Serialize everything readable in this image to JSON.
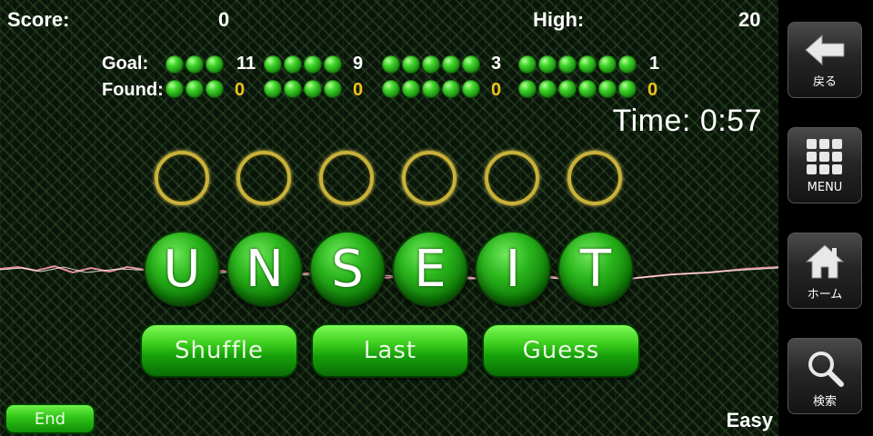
{
  "header": {
    "score_label": "Score:",
    "score_value": "0",
    "high_label": "High:",
    "high_value": "20"
  },
  "stats": {
    "goal_label": "Goal:",
    "found_label": "Found:",
    "groups": [
      {
        "balls": 3,
        "goal": "11",
        "found": "0"
      },
      {
        "balls": 4,
        "goal": "9",
        "found": "0"
      },
      {
        "balls": 5,
        "goal": "3",
        "found": "0"
      },
      {
        "balls": 6,
        "goal": "1",
        "found": "0"
      }
    ]
  },
  "timer": {
    "label": "Time:",
    "value": "0:57"
  },
  "letters": [
    "U",
    "N",
    "S",
    "E",
    "I",
    "T"
  ],
  "buttons": {
    "shuffle": "Shuffle",
    "last": "Last",
    "guess": "Guess",
    "end": "End"
  },
  "difficulty": "Easy",
  "colors": {
    "tile_green": "#2bb61d",
    "found_yellow": "#f2c21b",
    "slot_gold": "#c9b23a"
  },
  "sidebar": {
    "back": {
      "label": "戻る",
      "icon": "back-arrow-icon"
    },
    "menu": {
      "label": "MENU",
      "icon": "grid-menu-icon"
    },
    "home": {
      "label": "ホーム",
      "icon": "home-icon"
    },
    "search": {
      "label": "検索",
      "icon": "search-icon"
    }
  }
}
